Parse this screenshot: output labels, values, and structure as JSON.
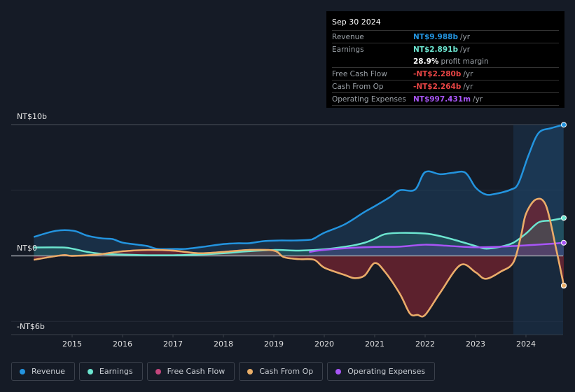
{
  "tooltip": {
    "date": "Sep 30 2024",
    "rows": [
      {
        "label": "Revenue",
        "value": "NT$9.988b",
        "unit": "/yr",
        "color": "#2394df"
      },
      {
        "label": "Earnings",
        "value": "NT$2.891b",
        "unit": "/yr",
        "color": "#6ce5d0"
      },
      {
        "label": "",
        "value": "28.9%",
        "unit": "profit margin",
        "color": "#ffffff"
      },
      {
        "label": "Free Cash Flow",
        "value": "-NT$2.280b",
        "unit": "/yr",
        "color": "#e84545"
      },
      {
        "label": "Cash From Op",
        "value": "-NT$2.264b",
        "unit": "/yr",
        "color": "#e84545"
      },
      {
        "label": "Operating Expenses",
        "value": "NT$997.431m",
        "unit": "/yr",
        "color": "#a855f7"
      }
    ]
  },
  "legend": [
    {
      "label": "Revenue",
      "color": "#2394df"
    },
    {
      "label": "Earnings",
      "color": "#6ce5d0"
    },
    {
      "label": "Free Cash Flow",
      "color": "#c4467d"
    },
    {
      "label": "Cash From Op",
      "color": "#e9ae68"
    },
    {
      "label": "Operating Expenses",
      "color": "#a855f7"
    }
  ],
  "chart_data": {
    "type": "area",
    "title": "",
    "xlabel": "",
    "ylabel": "",
    "unit": "NT$ billions",
    "ylim": [
      -6,
      10
    ],
    "xlim": [
      2014.2,
      2024.75
    ],
    "y_tick_labels": [
      {
        "value": 10,
        "label": "NT$10b"
      },
      {
        "value": 0,
        "label": "NT$0"
      },
      {
        "value": -6,
        "label": "-NT$6b"
      }
    ],
    "gridlines": [
      10,
      5,
      0,
      -5
    ],
    "x_ticks": [
      2015,
      2016,
      2017,
      2018,
      2019,
      2020,
      2021,
      2022,
      2023,
      2024
    ],
    "highlight_from": 2023.75,
    "series": [
      {
        "name": "Revenue",
        "color": "#2394df",
        "x": [
          2014.24,
          2014.68,
          2015.03,
          2015.3,
          2015.6,
          2015.8,
          2016.0,
          2016.3,
          2016.5,
          2016.7,
          2017.04,
          2017.25,
          2017.6,
          2018.0,
          2018.3,
          2018.5,
          2018.8,
          2019.1,
          2019.4,
          2019.7,
          2019.8,
          2020.0,
          2020.4,
          2020.8,
          2021.0,
          2021.3,
          2021.5,
          2021.8,
          2022.0,
          2022.3,
          2022.55,
          2022.8,
          2023.0,
          2023.2,
          2023.4,
          2023.7,
          2023.85,
          2024.05,
          2024.25,
          2024.5,
          2024.75
        ],
        "values": [
          1.44,
          1.91,
          1.91,
          1.54,
          1.33,
          1.28,
          1.01,
          0.85,
          0.74,
          0.53,
          0.53,
          0.53,
          0.69,
          0.9,
          0.96,
          0.96,
          1.12,
          1.17,
          1.17,
          1.22,
          1.33,
          1.76,
          2.39,
          3.35,
          3.78,
          4.47,
          5.0,
          5.05,
          6.38,
          6.22,
          6.33,
          6.33,
          5.21,
          4.68,
          4.73,
          5.05,
          5.53,
          7.66,
          9.36,
          9.73,
          9.99
        ]
      },
      {
        "name": "Earnings",
        "color": "#6ce5d0",
        "x": [
          2014.24,
          2014.8,
          2015.0,
          2015.3,
          2015.6,
          2016.0,
          2016.5,
          2017.0,
          2017.5,
          2018.0,
          2018.5,
          2019.0,
          2019.5,
          2020.0,
          2020.5,
          2020.8,
          2021.0,
          2021.2,
          2021.5,
          2022.0,
          2022.3,
          2022.6,
          2023.0,
          2023.2,
          2023.5,
          2023.75,
          2024.0,
          2024.25,
          2024.5,
          2024.75
        ],
        "values": [
          0.64,
          0.64,
          0.55,
          0.3,
          0.15,
          0.1,
          0.05,
          0.05,
          0.1,
          0.2,
          0.35,
          0.45,
          0.4,
          0.5,
          0.75,
          1.0,
          1.3,
          1.65,
          1.75,
          1.7,
          1.5,
          1.2,
          0.75,
          0.55,
          0.7,
          1.0,
          1.7,
          2.55,
          2.7,
          2.89
        ]
      },
      {
        "name": "Free Cash Flow",
        "color": "#c4467d",
        "x": [
          2014.24,
          2014.8,
          2015.0,
          2015.5,
          2016.0,
          2016.5,
          2017.0,
          2017.5,
          2018.0,
          2018.5,
          2019.0,
          2019.2,
          2019.5,
          2019.8,
          2020.0,
          2020.4,
          2020.6,
          2020.8,
          2021.0,
          2021.2,
          2021.5,
          2021.7,
          2021.85,
          2022.0,
          2022.3,
          2022.7,
          2023.0,
          2023.2,
          2023.5,
          2023.75,
          2023.9,
          2024.0,
          2024.2,
          2024.4,
          2024.6,
          2024.75
        ],
        "values": [
          -0.3,
          0.05,
          0.0,
          0.1,
          0.35,
          0.45,
          0.4,
          0.2,
          0.3,
          0.45,
          0.4,
          -0.1,
          -0.25,
          -0.3,
          -0.9,
          -1.45,
          -1.7,
          -1.5,
          -0.55,
          -1.2,
          -2.9,
          -4.4,
          -4.5,
          -4.5,
          -2.8,
          -0.7,
          -1.25,
          -1.75,
          -1.2,
          -0.5,
          1.5,
          3.2,
          4.3,
          3.8,
          0.5,
          -2.28
        ]
      },
      {
        "name": "Cash From Op",
        "color": "#e9ae68",
        "x": [
          2014.24,
          2014.8,
          2015.0,
          2015.5,
          2016.0,
          2016.5,
          2017.0,
          2017.5,
          2018.0,
          2018.5,
          2019.0,
          2019.2,
          2019.5,
          2019.8,
          2020.0,
          2020.4,
          2020.6,
          2020.8,
          2021.0,
          2021.2,
          2021.5,
          2021.7,
          2021.85,
          2022.0,
          2022.3,
          2022.7,
          2023.0,
          2023.2,
          2023.5,
          2023.75,
          2023.9,
          2024.0,
          2024.2,
          2024.4,
          2024.6,
          2024.75
        ],
        "values": [
          -0.3,
          0.05,
          0.0,
          0.1,
          0.35,
          0.45,
          0.4,
          0.2,
          0.3,
          0.45,
          0.4,
          -0.1,
          -0.25,
          -0.3,
          -0.9,
          -1.45,
          -1.7,
          -1.5,
          -0.55,
          -1.2,
          -2.9,
          -4.4,
          -4.5,
          -4.5,
          -2.8,
          -0.7,
          -1.25,
          -1.75,
          -1.2,
          -0.5,
          1.5,
          3.2,
          4.3,
          3.8,
          0.5,
          -2.26
        ]
      },
      {
        "name": "Operating Expenses",
        "color": "#a855f7",
        "x": [
          2019.7,
          2020.0,
          2020.5,
          2021.0,
          2021.5,
          2022.0,
          2022.5,
          2023.0,
          2023.5,
          2024.0,
          2024.5,
          2024.75
        ],
        "values": [
          0.3,
          0.45,
          0.6,
          0.68,
          0.7,
          0.85,
          0.75,
          0.65,
          0.7,
          0.8,
          0.92,
          1.0
        ]
      }
    ]
  }
}
